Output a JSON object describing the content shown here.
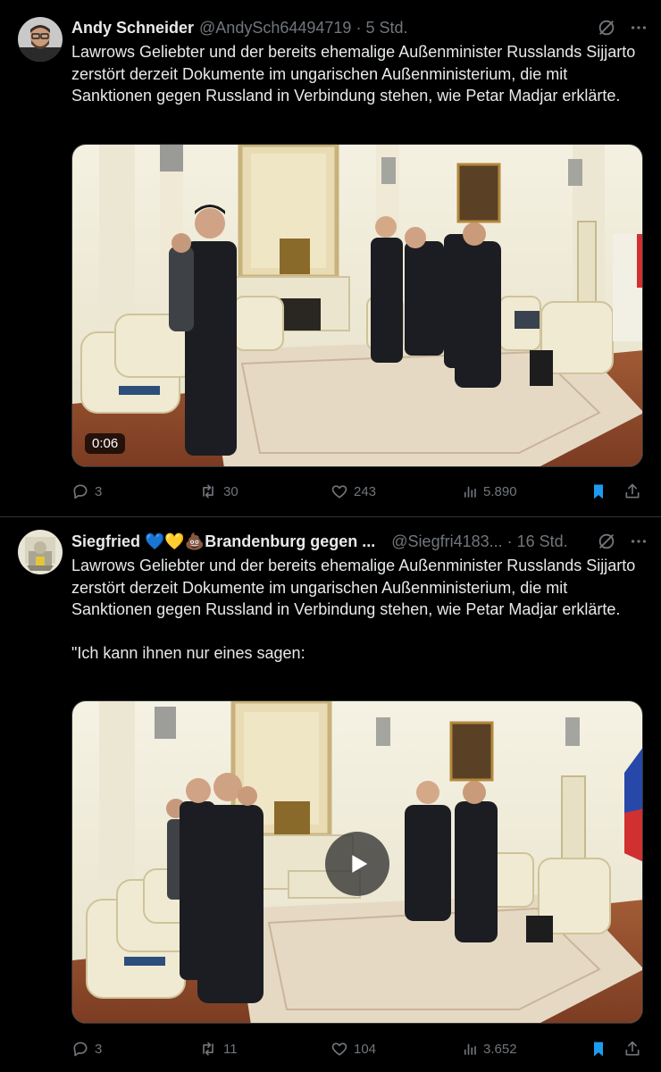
{
  "tweets": [
    {
      "author_name": "Andy Schneider",
      "handle": "@AndySch64494719",
      "time": "5 Std.",
      "paragraphs": [
        "Lawrows Geliebter und der bereits ehemalige Außenminister Russlands Sijjarto zerstört derzeit Dokumente im ungarischen Außenministerium, die mit Sanktionen gegen Russland in Verbindung stehen, wie Petar Madjar erklärte."
      ],
      "video_duration": "0:06",
      "replies": "3",
      "reposts": "30",
      "likes": "243",
      "views": "5.890"
    },
    {
      "author_name": "Siegfried 💙💛💩Brandenburg gegen ...",
      "handle": "@Siegfri4183...",
      "time": "16 Std.",
      "paragraphs": [
        "Lawrows Geliebter und der bereits ehemalige Außenminister Russlands Sijjarto zerstört derzeit Dokumente im ungarischen Außenministerium, die mit Sanktionen gegen Russland in Verbindung stehen, wie Petar Madjar erklärte.",
        "\"Ich kann ihnen nur eines sagen:"
      ],
      "replies": "3",
      "reposts": "11",
      "likes": "104",
      "views": "3.652"
    }
  ],
  "colors": {
    "background": "#000000",
    "text": "#e7e9ea",
    "muted": "#71767b",
    "bookmark_active": "#1d9bf0",
    "divider": "#2f3336"
  },
  "icons": [
    "grok-icon",
    "more-icon",
    "reply-icon",
    "repost-icon",
    "like-icon",
    "views-icon",
    "bookmark-icon",
    "share-icon",
    "play-icon"
  ]
}
